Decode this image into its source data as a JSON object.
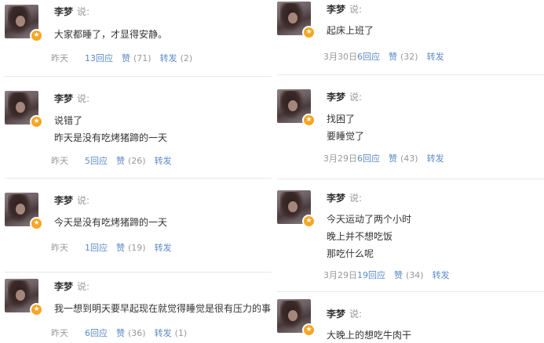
{
  "said_label": "说:",
  "posts_left": [
    {
      "author": "李梦",
      "lines": [
        "大家都睡了，才显得安静。"
      ],
      "date": "昨天",
      "reply_num": "13",
      "reply_label": "回应",
      "like_label": "赞",
      "like_count": "(71)",
      "forward_label": "转发",
      "forward_count": "(2)"
    },
    {
      "author": "李梦",
      "lines": [
        "说错了",
        "昨天是没有吃烤猪蹄的一天"
      ],
      "date": "昨天",
      "reply_num": "5",
      "reply_label": "回应",
      "like_label": "赞",
      "like_count": "(26)",
      "forward_label": "转发",
      "forward_count": ""
    },
    {
      "author": "李梦",
      "lines": [
        "今天是没有吃烤猪蹄的一天"
      ],
      "date": "昨天",
      "reply_num": "1",
      "reply_label": "回应",
      "like_label": "赞",
      "like_count": "(19)",
      "forward_label": "转发",
      "forward_count": ""
    },
    {
      "author": "李梦",
      "lines": [
        "我一想到明天要早起现在就觉得睡觉是很有压力的事"
      ],
      "date": "昨天",
      "reply_num": "6",
      "reply_label": "回应",
      "like_label": "赞",
      "like_count": "(36)",
      "forward_label": "转发",
      "forward_count": "(1)"
    }
  ],
  "posts_right": [
    {
      "author": "李梦",
      "lines": [
        "起床上班了"
      ],
      "date": "3月30日",
      "reply_num": "6",
      "reply_label": "回应",
      "like_label": "赞",
      "like_count": "(32)",
      "forward_label": "转发",
      "forward_count": ""
    },
    {
      "author": "李梦",
      "lines": [
        "找困了",
        "要睡觉了"
      ],
      "date": "3月29日",
      "reply_num": "6",
      "reply_label": "回应",
      "like_label": "赞",
      "like_count": "(43)",
      "forward_label": "转发",
      "forward_count": ""
    },
    {
      "author": "李梦",
      "lines": [
        "今天运动了两个小时",
        "晚上并不想吃饭",
        "那吃什么呢"
      ],
      "date": "3月29日",
      "reply_num": "19",
      "reply_label": "回应",
      "like_label": "赞",
      "like_count": "(34)",
      "forward_label": "转发",
      "forward_count": ""
    },
    {
      "author": "李梦",
      "lines": [
        "大晚上的想吃牛肉干"
      ],
      "date": "",
      "reply_num": "",
      "reply_label": "",
      "like_label": "",
      "like_count": "",
      "forward_label": "",
      "forward_count": ""
    }
  ],
  "colors": {
    "link": "#5b8bc7",
    "muted": "#999999",
    "badge": "#f5a623"
  },
  "icons": {
    "badge": "star-badge-icon"
  }
}
